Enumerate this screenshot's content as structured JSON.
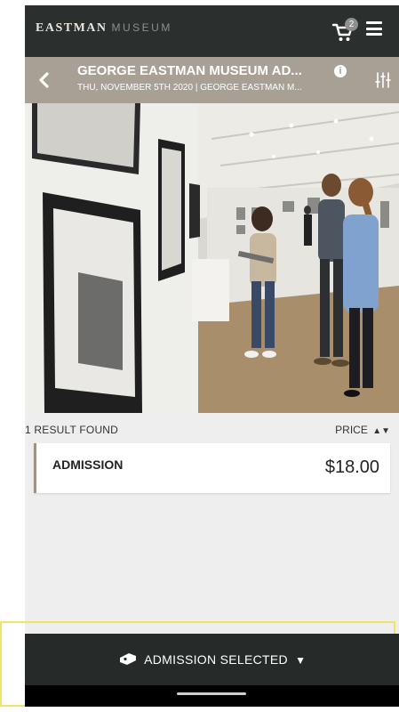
{
  "brand": {
    "logo_bold": "EASTMAN",
    "logo_light": "MUSEUM"
  },
  "header": {
    "cart_count": "2",
    "cart_icon": "cart-icon",
    "menu_icon": "hamburger-menu-icon"
  },
  "event": {
    "title": "GEORGE EASTMAN MUSEUM AD...",
    "subtitle": "THU, NOVEMBER 5TH 2020 | GEORGE EASTMAN M...",
    "back_icon": "chevron-left-icon",
    "info_glyph": "i",
    "filter_icon": "sliders-icon"
  },
  "results": {
    "count_label": "1 RESULT FOUND",
    "sort_label": "PRICE",
    "sort_glyph": "▲▼"
  },
  "tickets": [
    {
      "name": "ADMISSION",
      "price": "$18.00"
    }
  ],
  "footer": {
    "selected_label": "ADMISSION SELECTED",
    "selected_icon": "ticket-icon",
    "caret_glyph": "▼"
  },
  "colors": {
    "topbar": "#2b2f2e",
    "eventbar": "#a9a095",
    "accent": "#9e9384",
    "highlight": "#f1e36a",
    "bottombar": "#262b29"
  }
}
